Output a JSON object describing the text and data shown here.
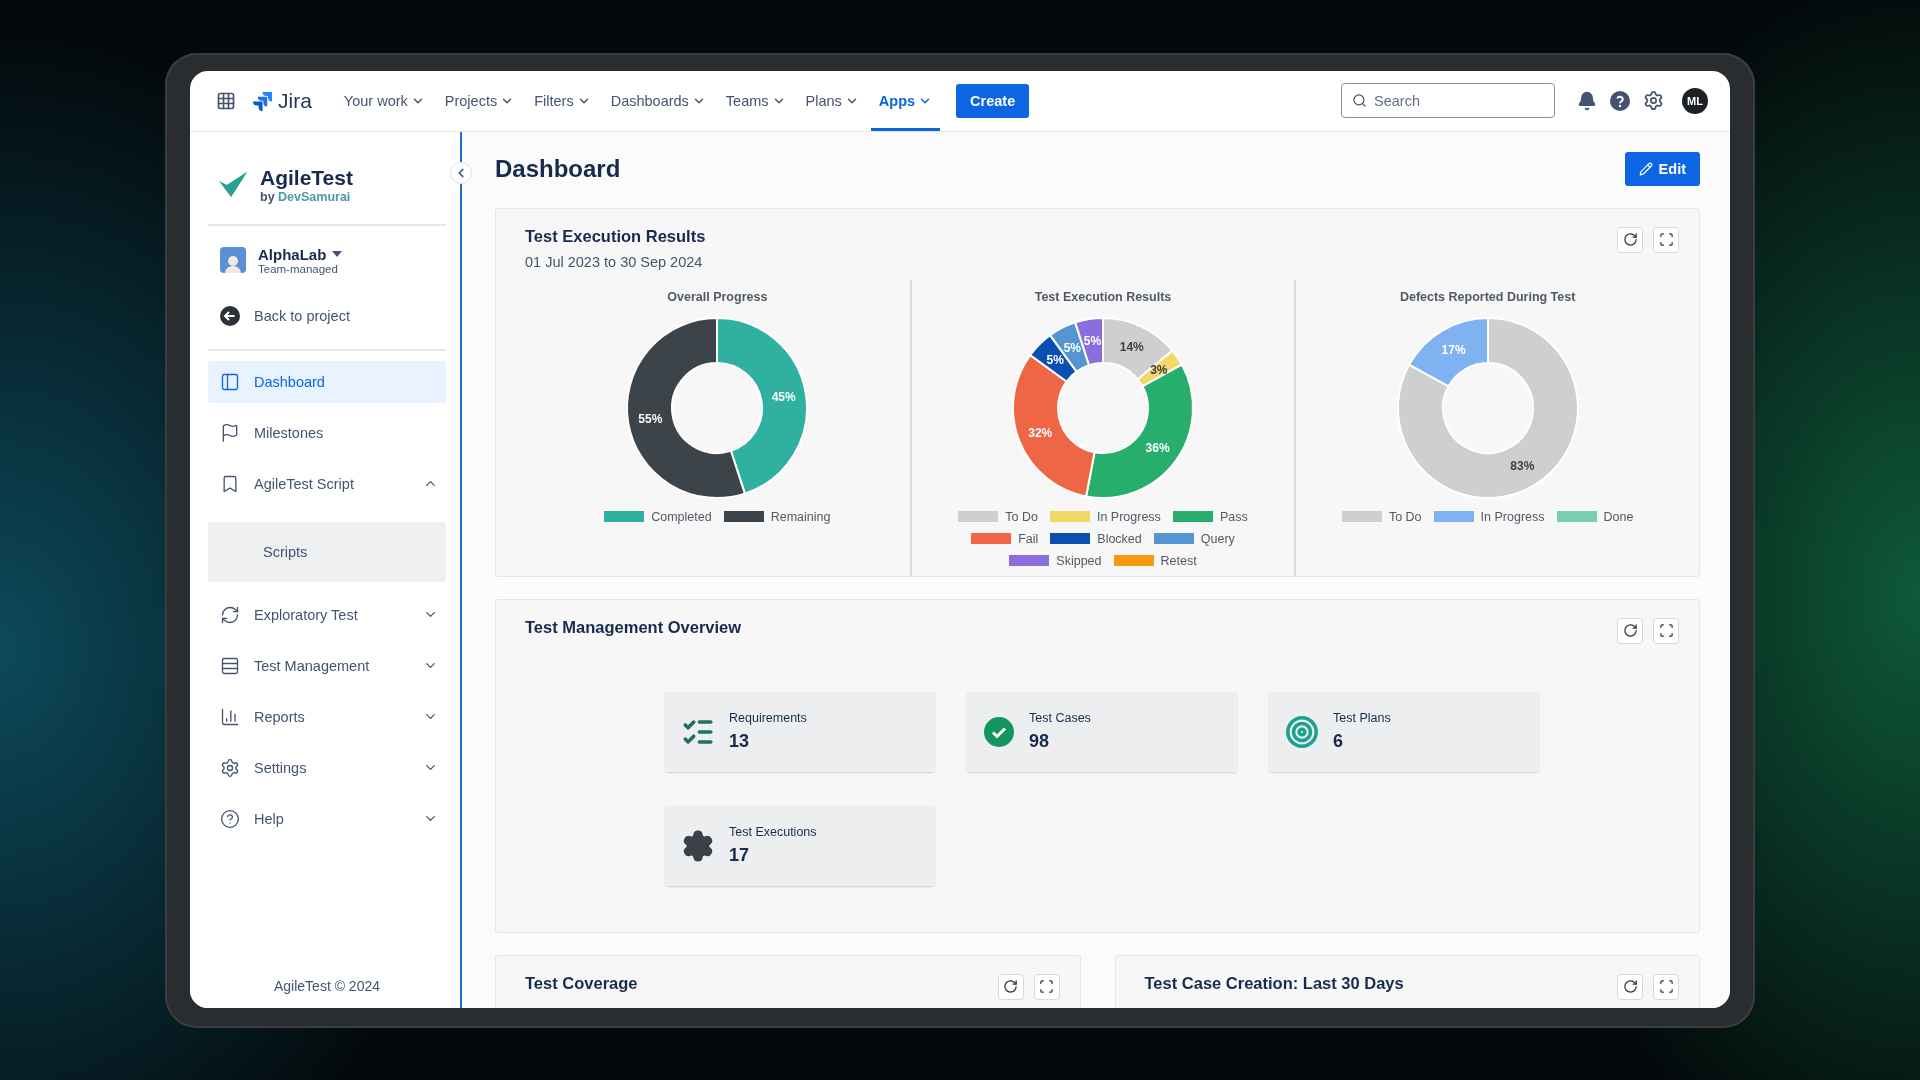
{
  "topnav": {
    "app_name": "Jira",
    "menus": [
      {
        "label": "Your work",
        "selected": false
      },
      {
        "label": "Projects",
        "selected": false
      },
      {
        "label": "Filters",
        "selected": false
      },
      {
        "label": "Dashboards",
        "selected": false
      },
      {
        "label": "Teams",
        "selected": false
      },
      {
        "label": "Plans",
        "selected": false
      },
      {
        "label": "Apps",
        "selected": true
      }
    ],
    "create_label": "Create",
    "search": {
      "placeholder": "Search"
    },
    "avatar": "ML"
  },
  "sidebar": {
    "brand": "AgileTest",
    "byline_prefix": "by",
    "byline_link": "DevSamurai",
    "project": {
      "name": "AlphaLab",
      "type": "Team-managed"
    },
    "back_label": "Back to project",
    "items": [
      {
        "kind": "link",
        "label": "Dashboard",
        "selected": true
      },
      {
        "kind": "link",
        "label": "Milestones",
        "selected": false
      },
      {
        "kind": "group",
        "label": "AgileTest Script",
        "selected": false,
        "expanded": true,
        "children": [
          {
            "label": "Scripts",
            "selected": false
          }
        ]
      },
      {
        "kind": "group",
        "label": "Exploratory Test",
        "selected": false,
        "expanded": false
      },
      {
        "kind": "group",
        "label": "Test Management",
        "selected": false,
        "expanded": false
      },
      {
        "kind": "group",
        "label": "Reports",
        "selected": false,
        "expanded": false
      },
      {
        "kind": "group",
        "label": "Settings",
        "selected": false,
        "expanded": false
      },
      {
        "kind": "group",
        "label": "Help",
        "selected": false,
        "expanded": false
      }
    ],
    "footer": "AgileTest © 2024"
  },
  "page": {
    "title": "Dashboard",
    "edit_label": "Edit"
  },
  "execution_card": {
    "title": "Test Execution Results",
    "date_range": "01 Jul 2023 to 30 Sep 2024",
    "charts": [
      {
        "chart_data": {
          "type": "donut",
          "title": "Overall Progress",
          "categories": [
            "Completed",
            "Remaining"
          ],
          "values": [
            45,
            55
          ],
          "colors": [
            "#2fb0a0",
            "#3c4349"
          ],
          "value_labels": [
            "45%",
            "55%"
          ]
        }
      },
      {
        "chart_data": {
          "type": "donut",
          "title": "Test Execution Results",
          "categories": [
            "To Do",
            "In Progress",
            "Pass",
            "Fail",
            "Blocked",
            "Query",
            "Skipped",
            "Retest"
          ],
          "values": [
            14,
            3,
            36,
            32,
            5,
            5,
            5,
            0
          ],
          "colors": [
            "#cfcfcf",
            "#f2d866",
            "#27ad6c",
            "#ef6647",
            "#0b4fb3",
            "#5596d2",
            "#8a6fdc",
            "#f39a12"
          ],
          "value_labels": [
            "14%",
            "3%",
            "36%",
            "32%",
            "5%",
            "5%",
            "5%",
            null
          ]
        }
      },
      {
        "chart_data": {
          "type": "donut",
          "title": "Defects Reported During Test",
          "categories": [
            "To Do",
            "In Progress",
            "Done"
          ],
          "values": [
            83,
            17,
            0
          ],
          "colors": [
            "#cfcfcf",
            "#7fb2f1",
            "#79cdb0"
          ],
          "value_labels": [
            "83%",
            "17%",
            null
          ]
        }
      }
    ]
  },
  "overview_card": {
    "title": "Test Management Overview",
    "stats": [
      {
        "kind": "requirements",
        "label": "Requirements",
        "count": "13"
      },
      {
        "kind": "cases",
        "label": "Test Cases",
        "count": "98"
      },
      {
        "kind": "plans",
        "label": "Test Plans",
        "count": "6"
      },
      {
        "kind": "executions",
        "label": "Test Executions",
        "count": "17"
      }
    ]
  },
  "bottom_cards": [
    {
      "title": "Test Coverage"
    },
    {
      "title": "Test Case Creation: Last 30 Days"
    }
  ]
}
